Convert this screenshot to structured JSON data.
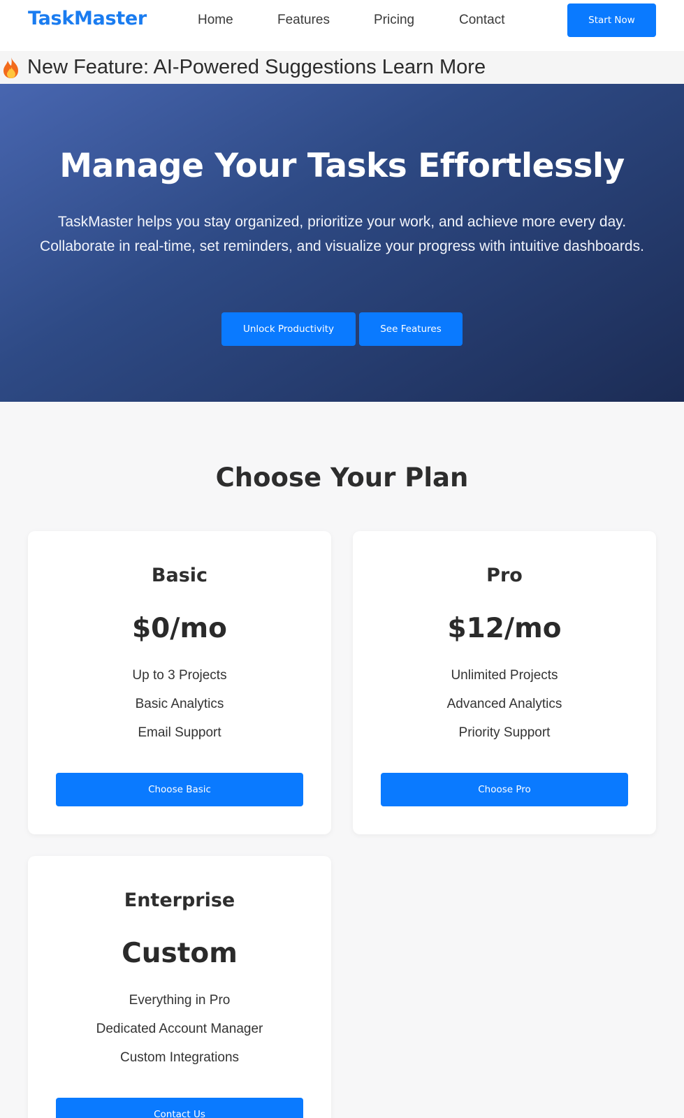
{
  "nav": {
    "logo": "TaskMaster",
    "links": [
      "Home",
      "Features",
      "Pricing",
      "Contact"
    ],
    "cta": "Start Now"
  },
  "banner": {
    "icon": "fire-icon",
    "text": "New Feature: AI-Powered Suggestions Learn More"
  },
  "hero": {
    "title": "Manage Your Tasks Effortlessly",
    "description": "TaskMaster helps you stay organized, prioritize your work, and achieve more every day. Collaborate in real-time, set reminders, and visualize your progress with intuitive dashboards.",
    "primary_button": "Unlock Productivity",
    "secondary_button": "See Features"
  },
  "pricing": {
    "title": "Choose Your Plan",
    "plans": [
      {
        "name": "Basic",
        "price": "$0/mo",
        "features": [
          "Up to 3 Projects",
          "Basic Analytics",
          "Email Support"
        ],
        "button": "Choose Basic"
      },
      {
        "name": "Pro",
        "price": "$12/mo",
        "features": [
          "Unlimited Projects",
          "Advanced Analytics",
          "Priority Support"
        ],
        "button": "Choose Pro"
      },
      {
        "name": "Enterprise",
        "price": "Custom",
        "features": [
          "Everything in Pro",
          "Dedicated Account Manager",
          "Custom Integrations"
        ],
        "button": "Contact Us"
      }
    ]
  },
  "colors": {
    "brand": "#1a7cf0",
    "button": "#0a7aff",
    "hero_start": "#4866b0",
    "hero_end": "#1c2c55"
  }
}
